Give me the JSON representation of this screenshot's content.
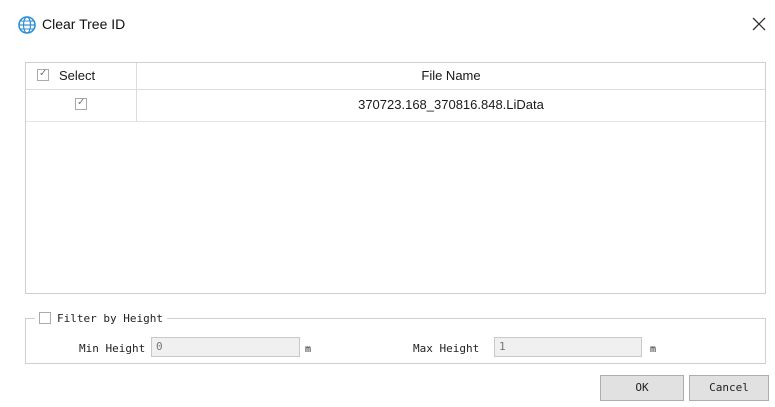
{
  "dialog": {
    "title": "Clear Tree ID",
    "app_icon": "globe-icon",
    "close_icon": "close-icon"
  },
  "grid": {
    "columns": [
      "Select",
      "File Name"
    ],
    "rows": [
      {
        "selected": true,
        "file_name": "370723.168_370816.848.LiData"
      }
    ]
  },
  "filter": {
    "label": "Filter by Height",
    "enabled": false,
    "min_label": "Min Height",
    "min_value": "0",
    "min_unit": "m",
    "max_label": "Max Height",
    "max_value": "1",
    "max_unit": "m"
  },
  "buttons": {
    "ok": "OK",
    "cancel": "Cancel"
  },
  "colors": {
    "accent": "#2e8fd6",
    "button_face": "#e1e1e1",
    "border": "#cfcfcf"
  }
}
